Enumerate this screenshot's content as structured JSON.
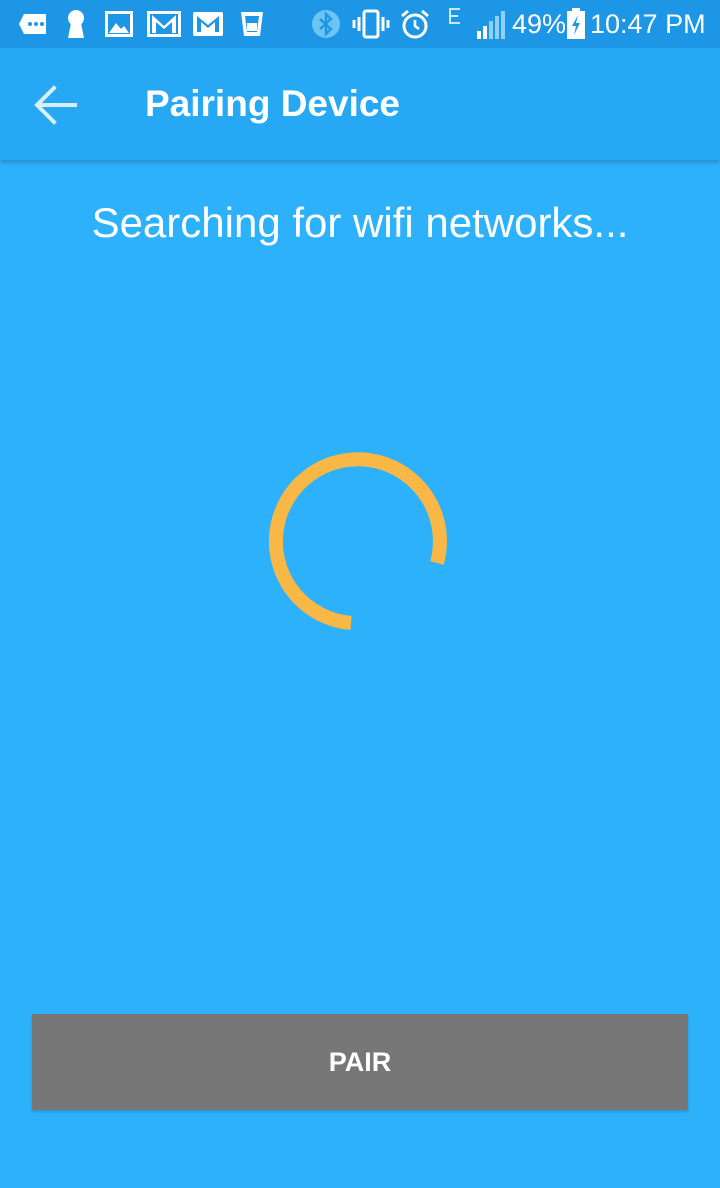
{
  "status_bar": {
    "battery_percent": "49%",
    "time": "10:47 PM",
    "notification_icons": [
      "message-icon",
      "keyhole-icon",
      "gallery-icon",
      "gmail-icon",
      "gmail-icon",
      "cup-icon"
    ],
    "system_icons": [
      "bluetooth-icon",
      "vibrate-icon",
      "alarm-icon",
      "network-e-icon",
      "signal-icon",
      "battery-charging-icon"
    ]
  },
  "app_bar": {
    "title": "Pairing Device",
    "back_icon": "arrow-back-icon"
  },
  "main": {
    "status_message": "Searching for wifi networks...",
    "spinner_icon": "loading-spinner-icon"
  },
  "actions": {
    "pair_label": "PAIR"
  },
  "colors": {
    "background": "#2eb1fb",
    "app_bar": "#27a8f5",
    "status_bar": "#1e96e6",
    "spinner": "#f9b845",
    "button": "#777777",
    "text": "#ffffff"
  }
}
